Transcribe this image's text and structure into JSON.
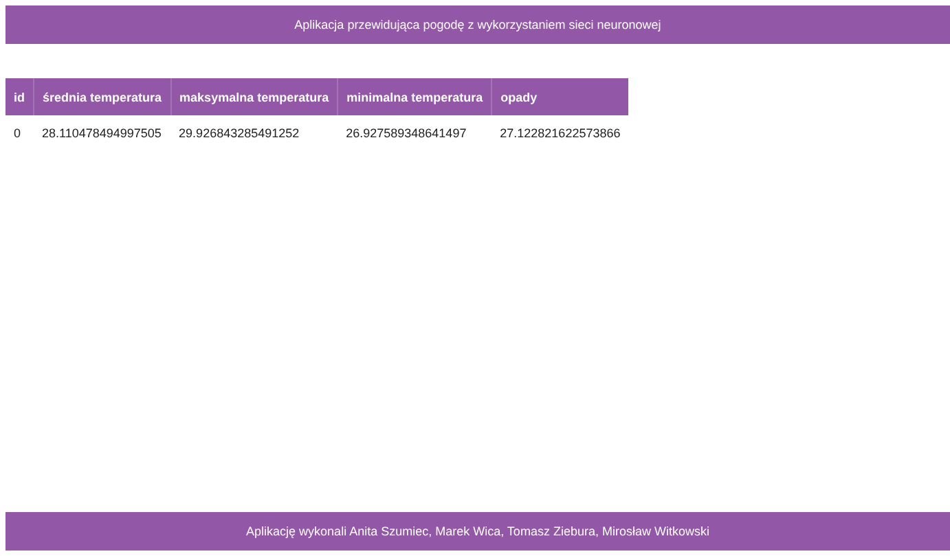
{
  "header": {
    "title": "Aplikacja przewidująca pogodę z wykorzystaniem sieci neuronowej"
  },
  "table": {
    "columns": [
      "id",
      "średnia temperatura",
      "maksymalna temperatura",
      "minimalna temperatura",
      "opady"
    ],
    "rows": [
      [
        "0",
        "28.110478494997505",
        "29.926843285491252",
        "26.927589348641497",
        "27.122821622573866"
      ]
    ]
  },
  "footer": {
    "text": "Aplikację wykonali Anita Szumiec, Marek Wica, Tomasz Ziebura, Mirosław Witkowski"
  }
}
